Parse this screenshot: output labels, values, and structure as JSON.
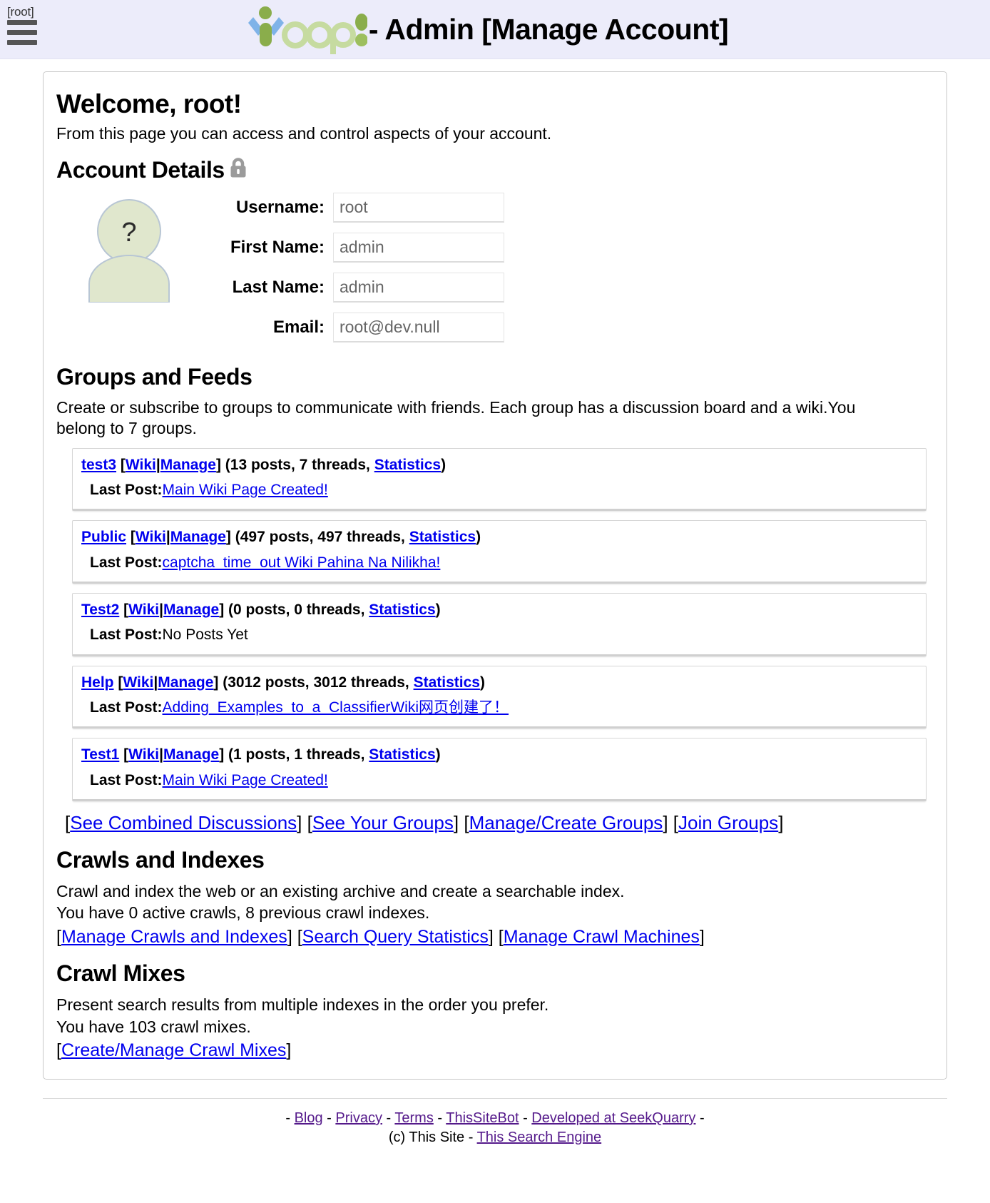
{
  "header": {
    "menu_label": "[root]",
    "logo_text": "Yioop",
    "title": "- Admin [Manage Account]"
  },
  "welcome": {
    "heading": "Welcome, root!",
    "subtitle": "From this page you can access and control aspects of your account."
  },
  "account_details": {
    "heading": "Account Details",
    "lock_icon": "lock-icon",
    "avatar_placeholder": "?",
    "fields": [
      {
        "label": "Username:",
        "value": "root"
      },
      {
        "label": "First Name:",
        "value": "admin"
      },
      {
        "label": "Last Name:",
        "value": "admin"
      },
      {
        "label": "Email:",
        "value": "root@dev.null"
      }
    ]
  },
  "groups_and_feeds": {
    "heading": "Groups and Feeds",
    "description": "Create or subscribe to groups to communicate with friends. Each group has a discussion board and a wiki.You belong to 7 groups.",
    "open_bracket": "[",
    "close_bracket": "]",
    "pipe": "|",
    "wiki_label": "Wiki",
    "manage_label": "Manage",
    "statistics_label": "Statistics",
    "last_post_label": "Last Post:",
    "items": [
      {
        "name": "test3",
        "counts": " (13 posts, 7 threads, ",
        "counts_tail": ")",
        "last_post": "Main Wiki Page Created!",
        "last_post_is_link": true
      },
      {
        "name": "Public",
        "counts": " (497 posts, 497 threads, ",
        "counts_tail": ")",
        "last_post": "captcha_time_out Wiki Pahina Na Nilikha!",
        "last_post_is_link": true
      },
      {
        "name": "Test2",
        "counts": " (0 posts, 0 threads, ",
        "counts_tail": ")",
        "last_post": "No Posts Yet",
        "last_post_is_link": false
      },
      {
        "name": "Help",
        "counts": " (3012 posts, 3012 threads, ",
        "counts_tail": ")",
        "last_post": "Adding_Examples_to_a_ClassifierWiki网页创建了！",
        "last_post_is_link": true
      },
      {
        "name": "Test1",
        "counts": " (1 posts, 1 threads, ",
        "counts_tail": ")",
        "last_post": "Main Wiki Page Created!",
        "last_post_is_link": true
      }
    ],
    "nav_links": [
      "See Combined Discussions",
      "See Your Groups",
      "Manage/Create Groups",
      "Join Groups"
    ]
  },
  "crawls_and_indexes": {
    "heading": "Crawls and Indexes",
    "line1": "Crawl and index the web or an existing archive and create a searchable index.",
    "line2": "You have 0 active crawls, 8 previous crawl indexes.",
    "links": [
      "Manage Crawls and Indexes",
      "Search Query Statistics",
      "Manage Crawl Machines"
    ]
  },
  "crawl_mixes": {
    "heading": "Crawl Mixes",
    "line1": "Present search results from multiple indexes in the order you prefer.",
    "line2": "You have 103 crawl mixes.",
    "links": [
      "Create/Manage Crawl Mixes"
    ]
  },
  "footer": {
    "dash": "-",
    "links_row1": [
      "Blog",
      "Privacy",
      "Terms",
      "ThisSiteBot",
      "Developed at SeekQuarry"
    ],
    "copyright": "(c) This Site -",
    "engine_link": "This Search Engine"
  },
  "colors": {
    "header_bg": "#ececfa",
    "link": "#0000EE",
    "visited_link": "#551A8B",
    "logo_green": "#8aad4b",
    "logo_light_green": "#c6dba0",
    "logo_blue": "#7fb3e8",
    "avatar_fill": "#e0e7cd"
  }
}
